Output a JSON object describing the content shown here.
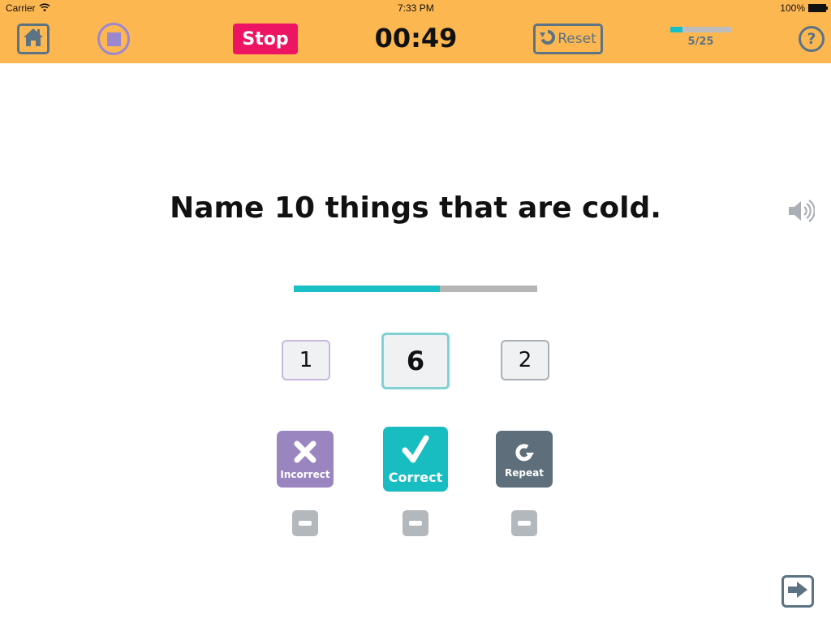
{
  "status_bar": {
    "carrier": "Carrier",
    "time": "7:33 PM",
    "battery": "100%"
  },
  "toolbar": {
    "stop_label": "Stop",
    "timer": "00:49",
    "reset_label": "Reset",
    "progress": {
      "current": 5,
      "total": 25,
      "label": "5/25",
      "fraction": 0.2
    },
    "help_label": "?"
  },
  "question": {
    "text": "Name 10 things that are cold.",
    "progress_fraction": 0.6
  },
  "counts": {
    "incorrect": "1",
    "correct": "6",
    "repeat": "2"
  },
  "actions": {
    "incorrect_label": "Incorrect",
    "correct_label": "Correct",
    "repeat_label": "Repeat"
  },
  "colors": {
    "topbar": "#FDB751",
    "stop": "#EE1464",
    "accent": "#18BFC4",
    "incorrect": "#9A85C0",
    "repeat": "#5E6F7B",
    "icon": "#5C7383"
  }
}
